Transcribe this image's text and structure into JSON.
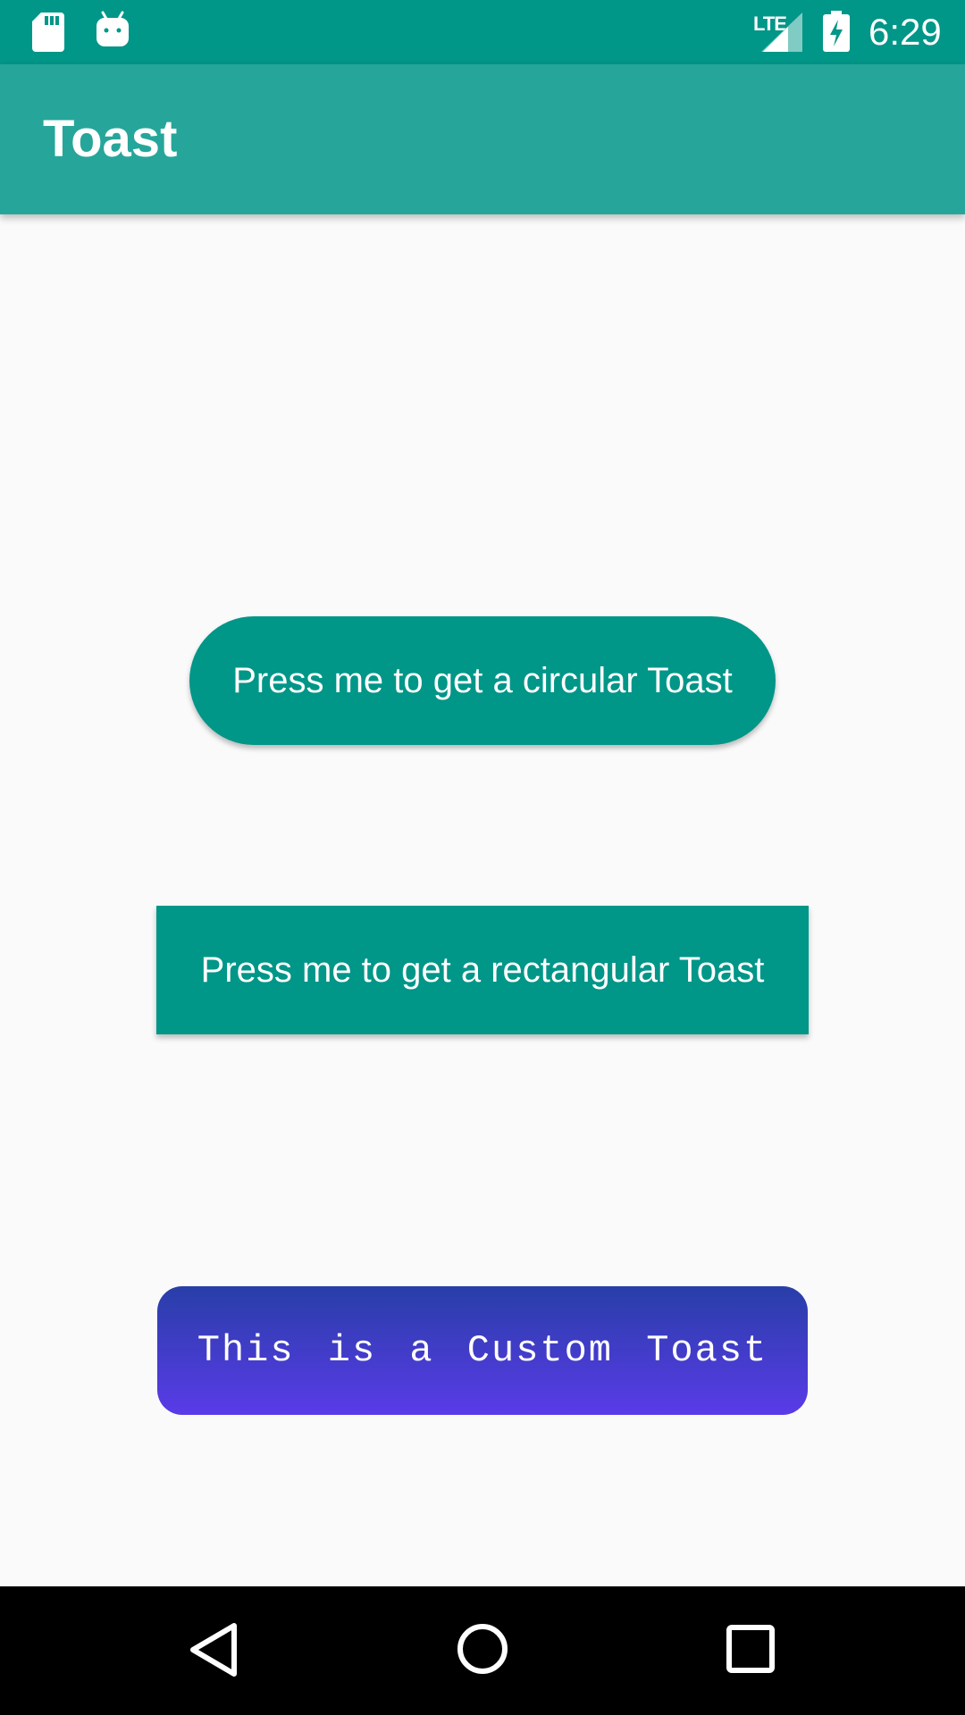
{
  "status_bar": {
    "time": "6:29",
    "network": "LTE",
    "icons": [
      "sd-card-icon",
      "android-icon",
      "signal-icon",
      "battery-charging-icon"
    ]
  },
  "app_bar": {
    "title": "Toast"
  },
  "main": {
    "circular_button_label": "Press me to get a circular Toast",
    "rect_button_label": "Press me to get a rectangular Toast",
    "custom_toast_text": "This is a Custom Toast"
  },
  "nav_bar": {
    "icons": [
      "back-icon",
      "home-icon",
      "recents-icon"
    ]
  },
  "colors": {
    "status_bar": "#009688",
    "app_bar": "#26a69a",
    "button": "#009688",
    "toast_gradient_top": "#283ea8",
    "toast_gradient_bottom": "#5a3be8",
    "nav_bar": "#000000"
  }
}
